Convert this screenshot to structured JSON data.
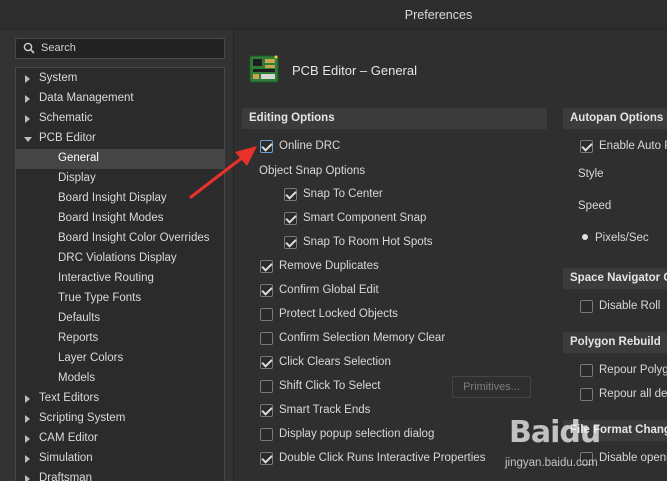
{
  "window": {
    "title": "Preferences"
  },
  "search": {
    "placeholder": "Search",
    "icon": "search-icon"
  },
  "tree": {
    "items": [
      {
        "label": "System",
        "level": 0,
        "expanded": false
      },
      {
        "label": "Data Management",
        "level": 0,
        "expanded": false
      },
      {
        "label": "Schematic",
        "level": 0,
        "expanded": false
      },
      {
        "label": "PCB Editor",
        "level": 0,
        "expanded": true
      },
      {
        "label": "General",
        "level": 1,
        "selected": true
      },
      {
        "label": "Display",
        "level": 1
      },
      {
        "label": "Board Insight Display",
        "level": 1
      },
      {
        "label": "Board Insight Modes",
        "level": 1
      },
      {
        "label": "Board Insight Color Overrides",
        "level": 1
      },
      {
        "label": "DRC Violations Display",
        "level": 1
      },
      {
        "label": "Interactive Routing",
        "level": 1
      },
      {
        "label": "True Type Fonts",
        "level": 1
      },
      {
        "label": "Defaults",
        "level": 1
      },
      {
        "label": "Reports",
        "level": 1
      },
      {
        "label": "Layer Colors",
        "level": 1
      },
      {
        "label": "Models",
        "level": 1
      },
      {
        "label": "Text Editors",
        "level": 0,
        "expanded": false
      },
      {
        "label": "Scripting System",
        "level": 0,
        "expanded": false
      },
      {
        "label": "CAM Editor",
        "level": 0,
        "expanded": false
      },
      {
        "label": "Simulation",
        "level": 0,
        "expanded": false
      },
      {
        "label": "Draftsman",
        "level": 0,
        "expanded": false
      }
    ]
  },
  "page": {
    "title": "PCB Editor – General",
    "icon": "pcb-board-icon"
  },
  "editing": {
    "header": "Editing Options",
    "online_drc": {
      "label": "Online DRC",
      "checked": true
    },
    "snap_group_label": "Object Snap Options",
    "snap_options": [
      {
        "label": "Snap To Center",
        "checked": true
      },
      {
        "label": "Smart Component Snap",
        "checked": true
      },
      {
        "label": "Snap To Room Hot Spots",
        "checked": true
      }
    ],
    "options": [
      {
        "label": "Remove Duplicates",
        "checked": true
      },
      {
        "label": "Confirm Global Edit",
        "checked": true
      },
      {
        "label": "Protect Locked Objects",
        "checked": false
      },
      {
        "label": "Confirm Selection Memory Clear",
        "checked": false
      },
      {
        "label": "Click Clears Selection",
        "checked": true
      },
      {
        "label": "Shift Click To Select",
        "checked": false
      },
      {
        "label": "Smart Track Ends",
        "checked": true
      },
      {
        "label": "Display popup selection dialog",
        "checked": false
      },
      {
        "label": "Double Click Runs Interactive Properties",
        "checked": true
      }
    ],
    "primitives_button": "Primitives..."
  },
  "autopan": {
    "header": "Autopan Options",
    "enable": {
      "label": "Enable Auto P",
      "checked": true
    },
    "style_label": "Style",
    "speed_label": "Speed",
    "units": {
      "label": "Pixels/Sec",
      "selected": true
    }
  },
  "space_nav": {
    "header": "Space Navigator Op",
    "disable_roll": {
      "label": "Disable Roll",
      "checked": false
    }
  },
  "polygon": {
    "header": "Polygon Rebuild",
    "repour": {
      "label": "Repour Polyg",
      "checked": false
    },
    "repour_all": {
      "label": "Repour all de",
      "checked": false
    }
  },
  "file_format": {
    "header": "File Format Change",
    "disable_opening": {
      "label": "Disable openi",
      "checked": false
    }
  },
  "watermark": {
    "text": "Baidu",
    "sub": "jingyan.baidu.com"
  },
  "annotation": {
    "color": "#e8312a"
  }
}
